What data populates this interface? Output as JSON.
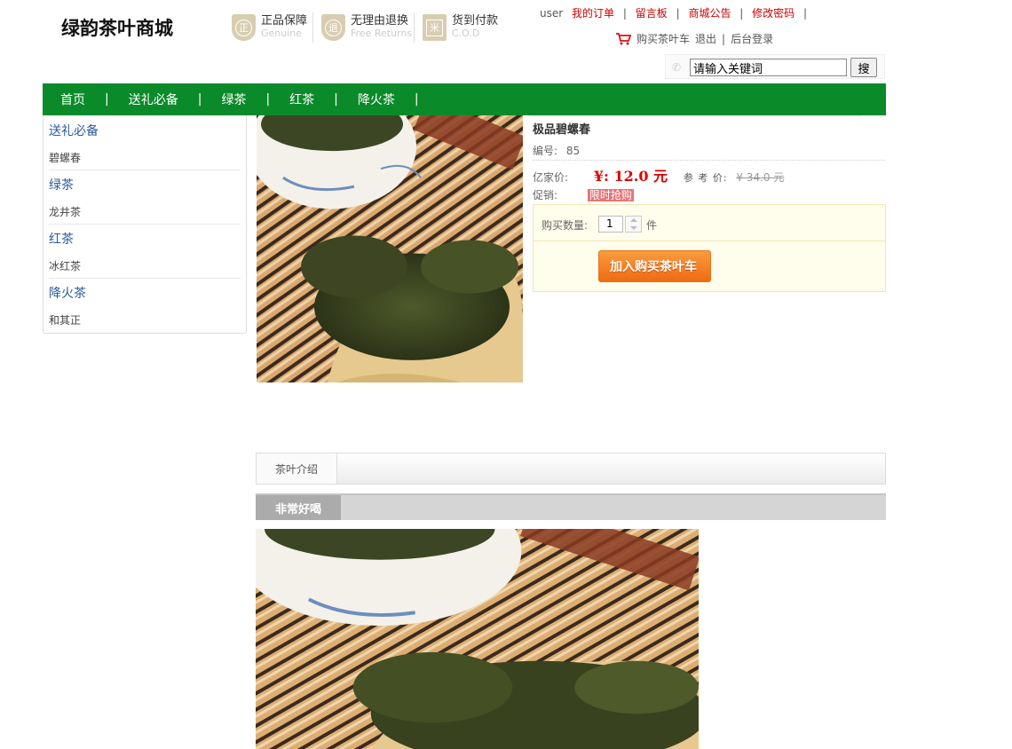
{
  "header": {
    "logo": "绿韵茶叶商城",
    "promises": [
      {
        "icon": "genuine-shield-icon",
        "glyph": "正",
        "title": "正品保障",
        "subtitle": "Genuine"
      },
      {
        "icon": "return-shield-icon",
        "glyph": "退",
        "title": "无理由退换",
        "subtitle": "Free Returns"
      },
      {
        "icon": "cod-package-icon",
        "glyph": "米",
        "title": "货到付款",
        "subtitle": "C.O.D"
      }
    ],
    "top_links": {
      "user": "user",
      "orders": "我的订单",
      "messages": "留言板",
      "notice": "商城公告",
      "password": "修改密码",
      "sep": "|"
    },
    "cart_line": {
      "cart": "购买茶叶车",
      "logout": "退出",
      "admin": "后台登录",
      "sep": "|"
    },
    "search": {
      "value": "请输入关键词",
      "button": "搜"
    }
  },
  "nav": {
    "items": [
      "首页",
      "送礼必备",
      "绿茶",
      "红茶",
      "降火茶"
    ],
    "sep": "|"
  },
  "sidebar": {
    "categories": [
      {
        "title": "送礼必备",
        "items": [
          "碧螺春"
        ]
      },
      {
        "title": "绿茶",
        "items": [
          "龙井茶"
        ]
      },
      {
        "title": "红茶",
        "items": [
          "冰红茶"
        ]
      },
      {
        "title": "降火茶",
        "items": [
          "和其正"
        ]
      }
    ]
  },
  "product": {
    "name": "极品碧螺春",
    "code_label": "编号:",
    "code": "85",
    "price_label": "亿家价:",
    "price": "¥: 12.0 元",
    "ref_label": "参 考 价:",
    "ref_price": "¥ 34.0 元",
    "promo_label": "促销:",
    "promo_tag": "限时抢购",
    "qty_label": "购买数量:",
    "qty": "1",
    "qty_unit": "件",
    "cart_button": "加入购买茶叶车"
  },
  "tabs": {
    "main": "茶叶介绍",
    "sub": "非常好喝"
  },
  "colors": {
    "nav_green": "#0b8a2a",
    "price_red": "#dd0000",
    "link_red": "#cc0000",
    "category_blue": "#2a5a9a",
    "cart_orange": "#f06a12"
  }
}
